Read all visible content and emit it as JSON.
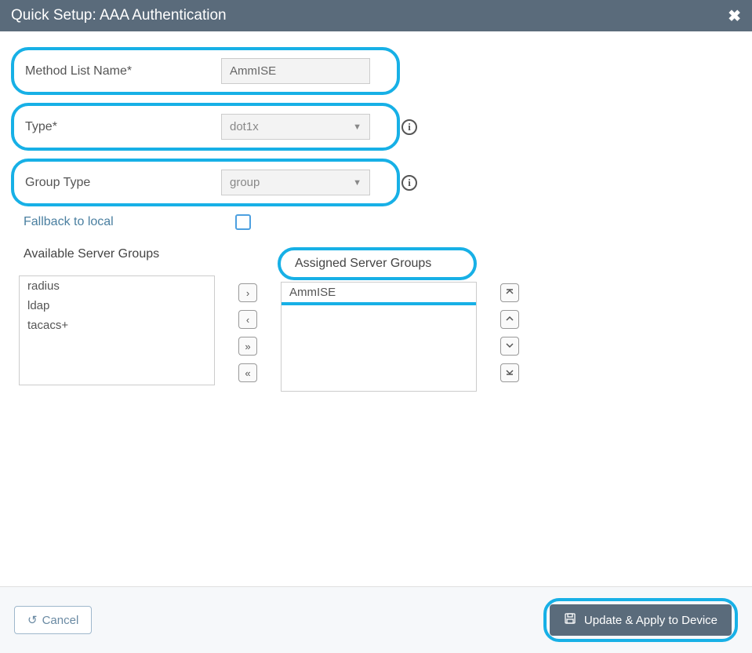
{
  "header": {
    "title": "Quick Setup: AAA Authentication"
  },
  "fields": {
    "method_list_name": {
      "label": "Method List Name*",
      "value": "AmmISE"
    },
    "type": {
      "label": "Type*",
      "value": "dot1x"
    },
    "group_type": {
      "label": "Group Type",
      "value": "group"
    },
    "fallback": {
      "label": "Fallback to local"
    }
  },
  "lists": {
    "available": {
      "header": "Available Server Groups",
      "items": [
        "radius",
        "ldap",
        "tacacs+"
      ]
    },
    "assigned": {
      "header": "Assigned Server Groups",
      "items": [
        "AmmISE"
      ]
    }
  },
  "footer": {
    "cancel": "Cancel",
    "apply": "Update & Apply to Device"
  }
}
